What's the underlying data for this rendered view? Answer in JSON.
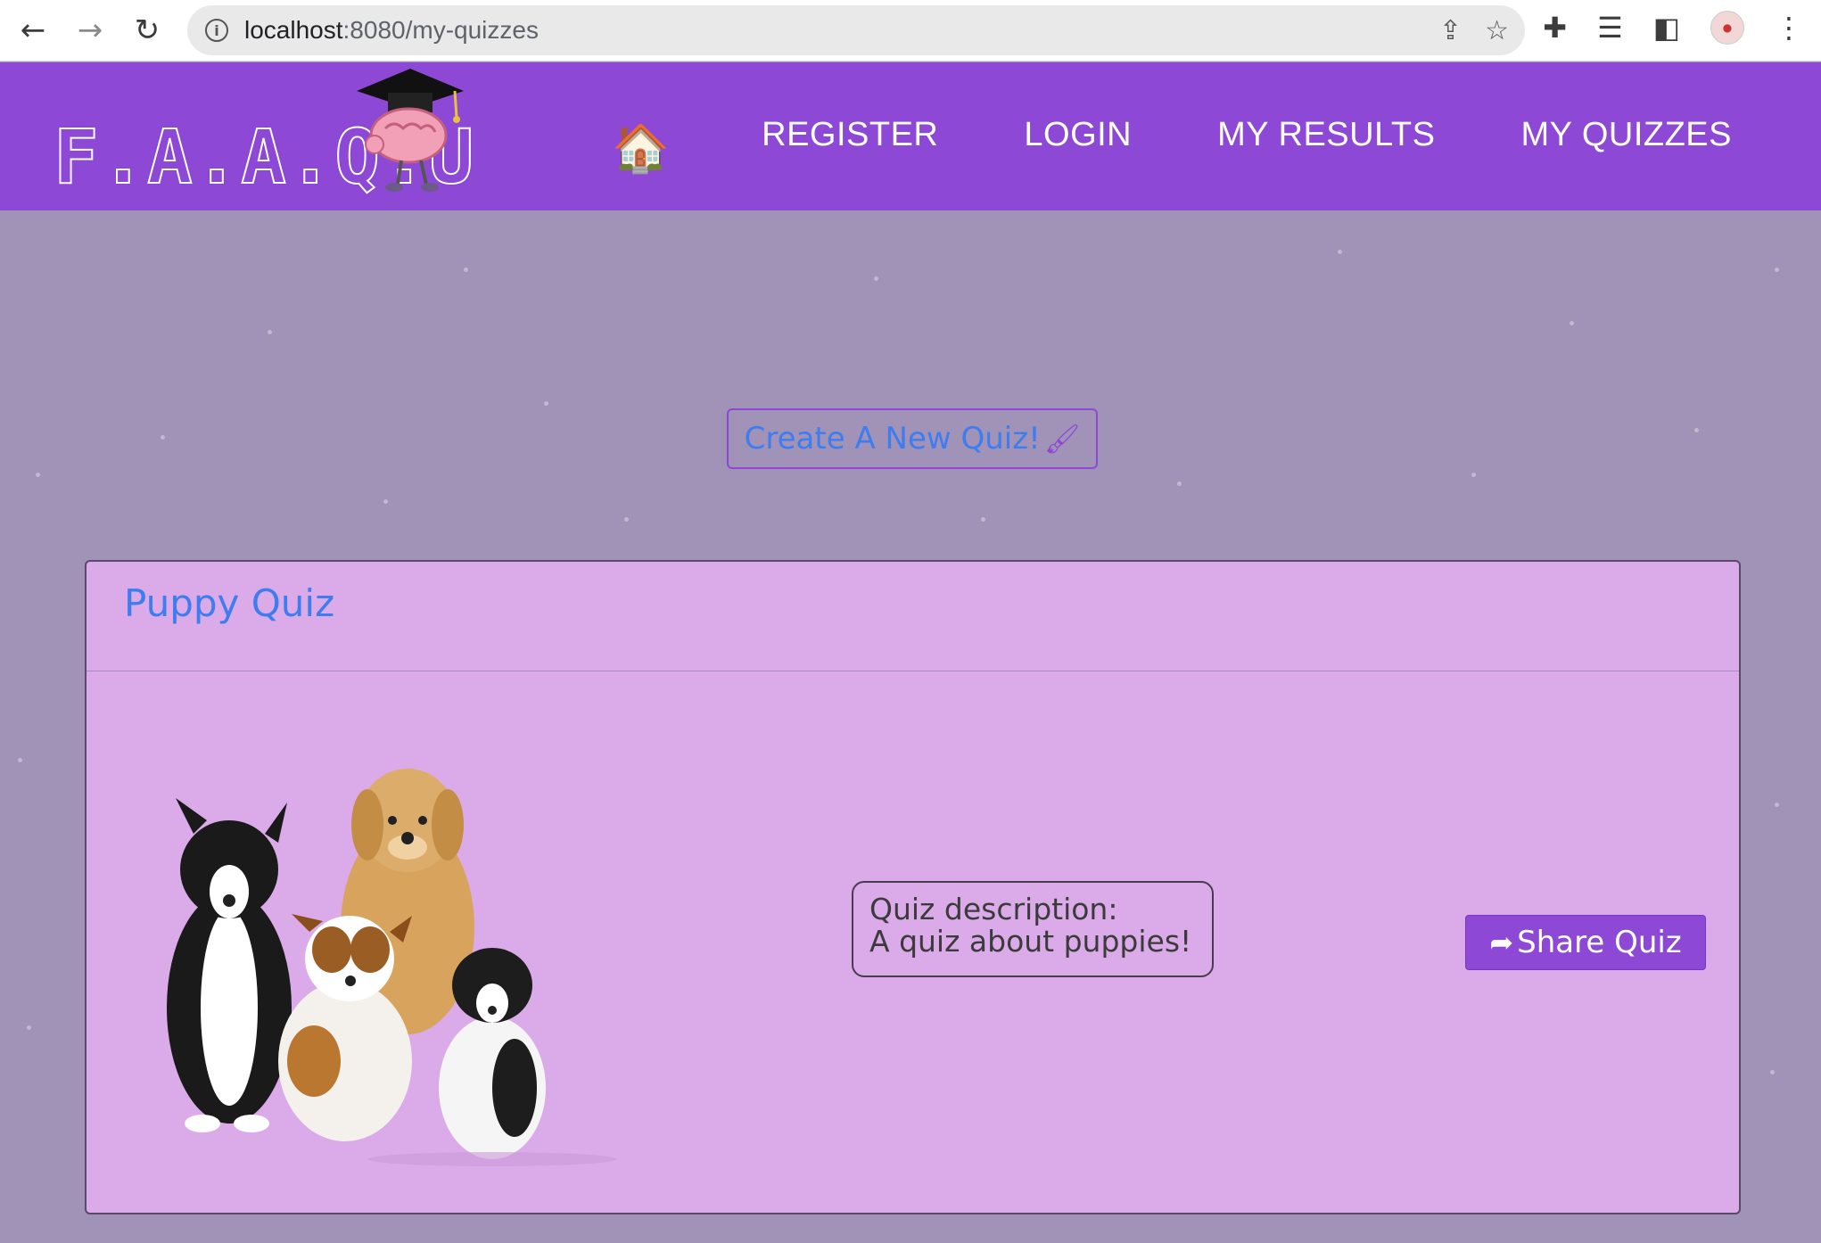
{
  "browser": {
    "url_host": "localhost",
    "url_path": ":8080/my-quizzes"
  },
  "header": {
    "logo_text": "F.A.A.Q.U",
    "nav": {
      "home_icon": "🏠",
      "register": "REGISTER",
      "login": "LOGIN",
      "my_results": "MY RESULTS",
      "my_quizzes": "MY QUIZZES"
    }
  },
  "main": {
    "create_button_label": "Create A New Quiz!",
    "brush_icon": "🖌"
  },
  "quiz": {
    "title": "Puppy Quiz",
    "description_label": "Quiz description:",
    "description_text": "A quiz about puppies!",
    "share_label": "Share Quiz",
    "share_icon": "➦"
  },
  "colors": {
    "header_bg": "#8e48d6",
    "page_bg": "#a192b8",
    "card_bg": "#dbaae9",
    "link_blue": "#3d7df0"
  }
}
